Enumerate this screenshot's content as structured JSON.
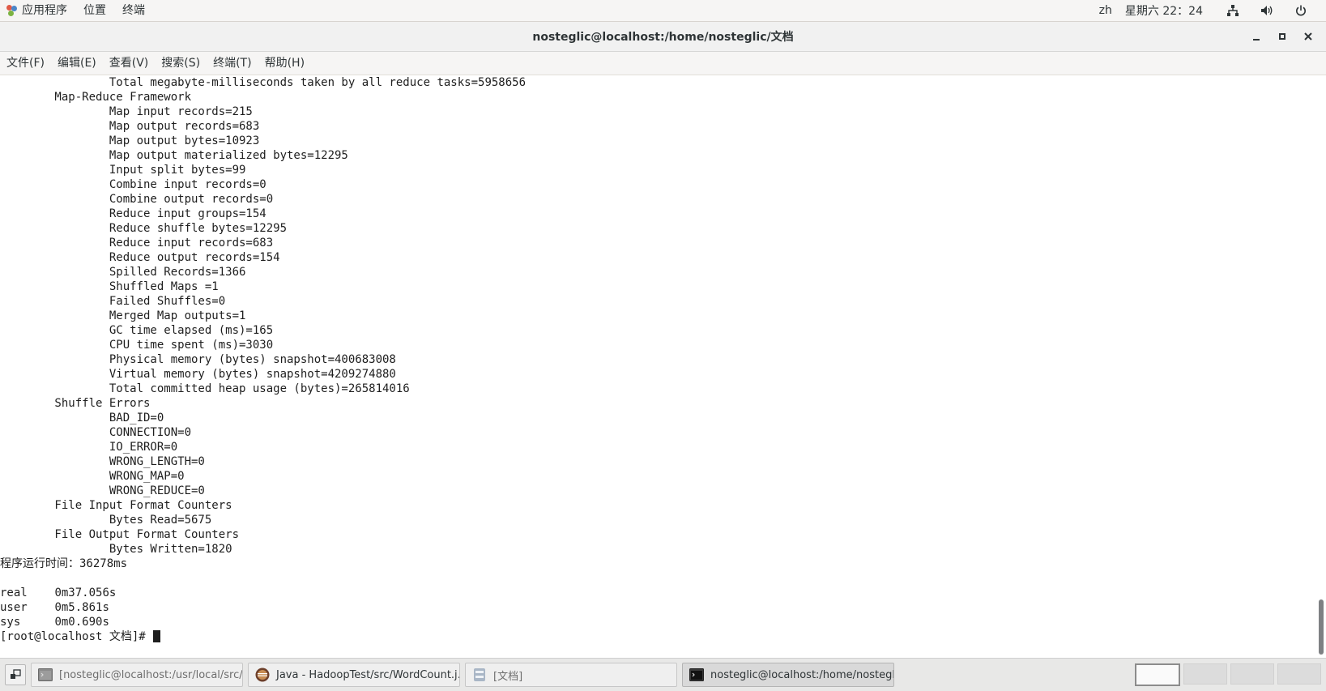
{
  "topbar": {
    "apps_label": "应用程序",
    "places_label": "位置",
    "terminal_label": "终端",
    "lang": "zh",
    "clock": "星期六 22：24"
  },
  "window": {
    "title": "nosteglic@localhost:/home/nosteglic/文档"
  },
  "menu": [
    "文件(F)",
    "编辑(E)",
    "查看(V)",
    "搜索(S)",
    "终端(T)",
    "帮助(H)"
  ],
  "terminal_lines": [
    "                Total megabyte-milliseconds taken by all reduce tasks=5958656",
    "        Map-Reduce Framework",
    "                Map input records=215",
    "                Map output records=683",
    "                Map output bytes=10923",
    "                Map output materialized bytes=12295",
    "                Input split bytes=99",
    "                Combine input records=0",
    "                Combine output records=0",
    "                Reduce input groups=154",
    "                Reduce shuffle bytes=12295",
    "                Reduce input records=683",
    "                Reduce output records=154",
    "                Spilled Records=1366",
    "                Shuffled Maps =1",
    "                Failed Shuffles=0",
    "                Merged Map outputs=1",
    "                GC time elapsed (ms)=165",
    "                CPU time spent (ms)=3030",
    "                Physical memory (bytes) snapshot=400683008",
    "                Virtual memory (bytes) snapshot=4209274880",
    "                Total committed heap usage (bytes)=265814016",
    "        Shuffle Errors",
    "                BAD_ID=0",
    "                CONNECTION=0",
    "                IO_ERROR=0",
    "                WRONG_LENGTH=0",
    "                WRONG_MAP=0",
    "                WRONG_REDUCE=0",
    "        File Input Format Counters",
    "                Bytes Read=5675",
    "        File Output Format Counters",
    "                Bytes Written=1820",
    "程序运行时间：36278ms",
    "",
    "real\t0m37.056s",
    "user\t0m5.861s",
    "sys\t0m0.690s"
  ],
  "prompt": "[root@localhost 文档]# ",
  "taskbar": {
    "tasks": [
      {
        "label": "[nosteglic@localhost:/usr/local/src/…",
        "icon": "terminal-icon"
      },
      {
        "label": "Java - HadoopTest/src/WordCount.j…",
        "icon": "eclipse-icon"
      },
      {
        "label": "[文档]",
        "icon": "file-manager-icon"
      },
      {
        "label": "nosteglic@localhost:/home/nostegli…",
        "icon": "terminal-icon"
      }
    ]
  }
}
